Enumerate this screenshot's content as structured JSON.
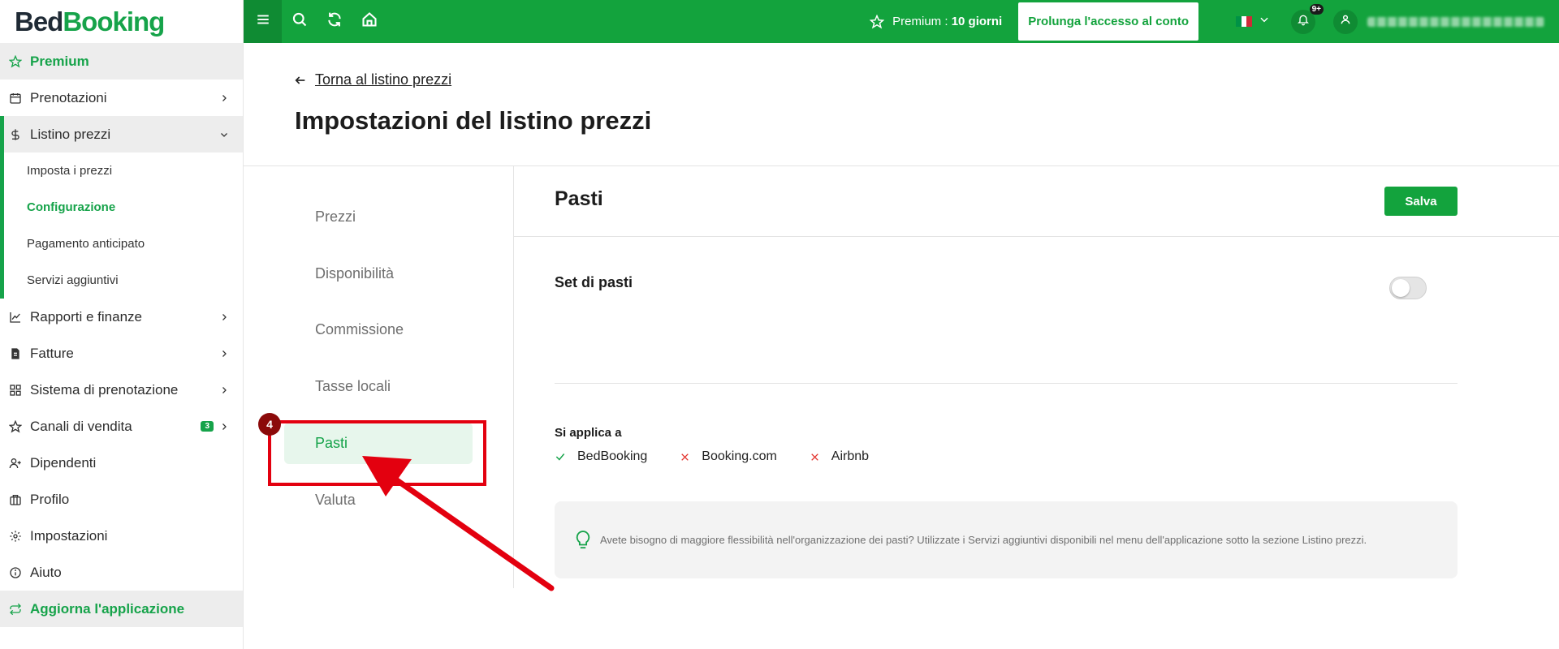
{
  "app": {
    "logo_part1": "Bed",
    "logo_part2": "Booking"
  },
  "sidebar": {
    "premium": "Premium",
    "items": [
      {
        "label": "Prenotazioni"
      },
      {
        "label": "Listino prezzi"
      },
      {
        "label": "Rapporti e finanze"
      },
      {
        "label": "Fatture"
      },
      {
        "label": "Sistema di prenotazione"
      },
      {
        "label": "Canali di vendita",
        "badge": "3"
      },
      {
        "label": "Dipendenti"
      },
      {
        "label": "Profilo"
      },
      {
        "label": "Impostazioni"
      },
      {
        "label": "Aiuto"
      }
    ],
    "subitems": [
      {
        "label": "Imposta i prezzi"
      },
      {
        "label": "Configurazione"
      },
      {
        "label": "Pagamento anticipato"
      },
      {
        "label": "Servizi aggiuntivi"
      }
    ],
    "update": "Aggiorna l'applicazione"
  },
  "topbar": {
    "premium_prefix": "Premium :",
    "premium_days": "10 giorni",
    "extend_button": "Prolunga l'accesso al conto",
    "notification_count": "9+"
  },
  "main": {
    "back_link": "Torna al listino prezzi",
    "page_title": "Impostazioni del listino prezzi",
    "tabs": [
      {
        "label": "Prezzi"
      },
      {
        "label": "Disponibilità"
      },
      {
        "label": "Commissione"
      },
      {
        "label": "Tasse locali"
      },
      {
        "label": "Pasti"
      },
      {
        "label": "Valuta"
      }
    ],
    "content": {
      "title": "Pasti",
      "save_button": "Salva",
      "meal_set_label": "Set di pasti",
      "meal_set_enabled": false,
      "applies_to_label": "Si applica a",
      "channels": [
        {
          "name": "BedBooking",
          "status": "check"
        },
        {
          "name": "Booking.com",
          "status": "cross"
        },
        {
          "name": "Airbnb",
          "status": "cross"
        }
      ],
      "info_text": "Avete bisogno di maggiore flessibilità nell'organizzazione dei pasti? Utilizzate i Servizi aggiuntivi disponibili nel menu dell'applicazione sotto la sezione Listino prezzi."
    }
  },
  "annotation": {
    "step": "4"
  },
  "colors": {
    "brand": "#13a33d",
    "brand_dark": "#0f8b33",
    "highlight": "#e3000f"
  }
}
